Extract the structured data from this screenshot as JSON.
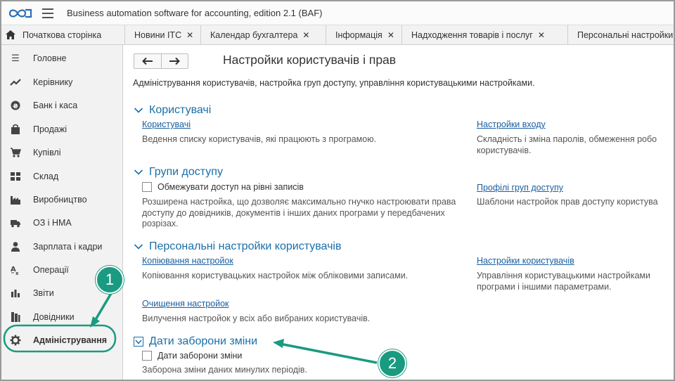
{
  "window": {
    "title": "Business automation software for accounting, edition 2.1  (BAF)"
  },
  "tabs": {
    "home_label": "Початкова сторінка",
    "items": [
      {
        "label": "Новини ІТС"
      },
      {
        "label": "Календар бухгалтера"
      },
      {
        "label": "Інформація"
      },
      {
        "label": "Надходження товарів і послуг"
      },
      {
        "label": "Персональні настройки"
      }
    ]
  },
  "sidebar": {
    "items": [
      {
        "label": "Головне",
        "icon": "list-icon"
      },
      {
        "label": "Керівнику",
        "icon": "trend-icon"
      },
      {
        "label": "Банк і каса",
        "icon": "coin-icon"
      },
      {
        "label": "Продажі",
        "icon": "bag-icon"
      },
      {
        "label": "Купівлі",
        "icon": "cart-icon"
      },
      {
        "label": "Склад",
        "icon": "warehouse-icon"
      },
      {
        "label": "Виробництво",
        "icon": "factory-icon"
      },
      {
        "label": "ОЗ і НМА",
        "icon": "truck-icon"
      },
      {
        "label": "Зарплата і кадри",
        "icon": "person-icon"
      },
      {
        "label": "Операції",
        "icon": "operations-icon"
      },
      {
        "label": "Звіти",
        "icon": "bar-chart-icon"
      },
      {
        "label": "Довідники",
        "icon": "books-icon"
      },
      {
        "label": "Адміністрування",
        "icon": "gear-icon"
      }
    ]
  },
  "main": {
    "title": "Настройки користувачів і прав",
    "description": "Адміністрування користувачів, настройка груп доступу, управління користувацькими настройками.",
    "sections": {
      "users": {
        "title": "Користувачі",
        "left_link": "Користувачі",
        "left_desc": "Ведення списку користувачів, які працюють з програмою.",
        "right_link": "Настройки входу",
        "right_desc": "Складність і зміна паролів, обмеження робо користувачів."
      },
      "groups": {
        "title": "Групи доступу",
        "checkbox": "Обмежувати доступ на рівні записів",
        "left_desc": "Розширена настройка, що дозволяє максимально гнучко настроювати права доступу до довідників, документів і інших даних програми у передбачених розрізах.",
        "right_link": "Профілі груп доступу",
        "right_desc": "Шаблони настройок прав доступу користува"
      },
      "personal": {
        "title": "Персональні настройки користувачів",
        "copy_link": "Копіювання настройок",
        "copy_desc": "Копіювання користувацьких настройок між обліковими записами.",
        "right_link": "Настройки користувачів",
        "right_desc": "Управління користувацькими настройками програми і іншими параметрами.",
        "clear_link": "Очищення настройок",
        "clear_desc": "Вилучення настройок у всіх або вибраних користувачів."
      },
      "dates": {
        "title": "Дати заборони зміни",
        "checkbox": "Дати заборони зміни",
        "desc": "Заборона зміни даних минулих періодів."
      }
    }
  },
  "annotations": {
    "badge1": "1",
    "badge2": "2",
    "accent_color": "#1a9a80"
  }
}
